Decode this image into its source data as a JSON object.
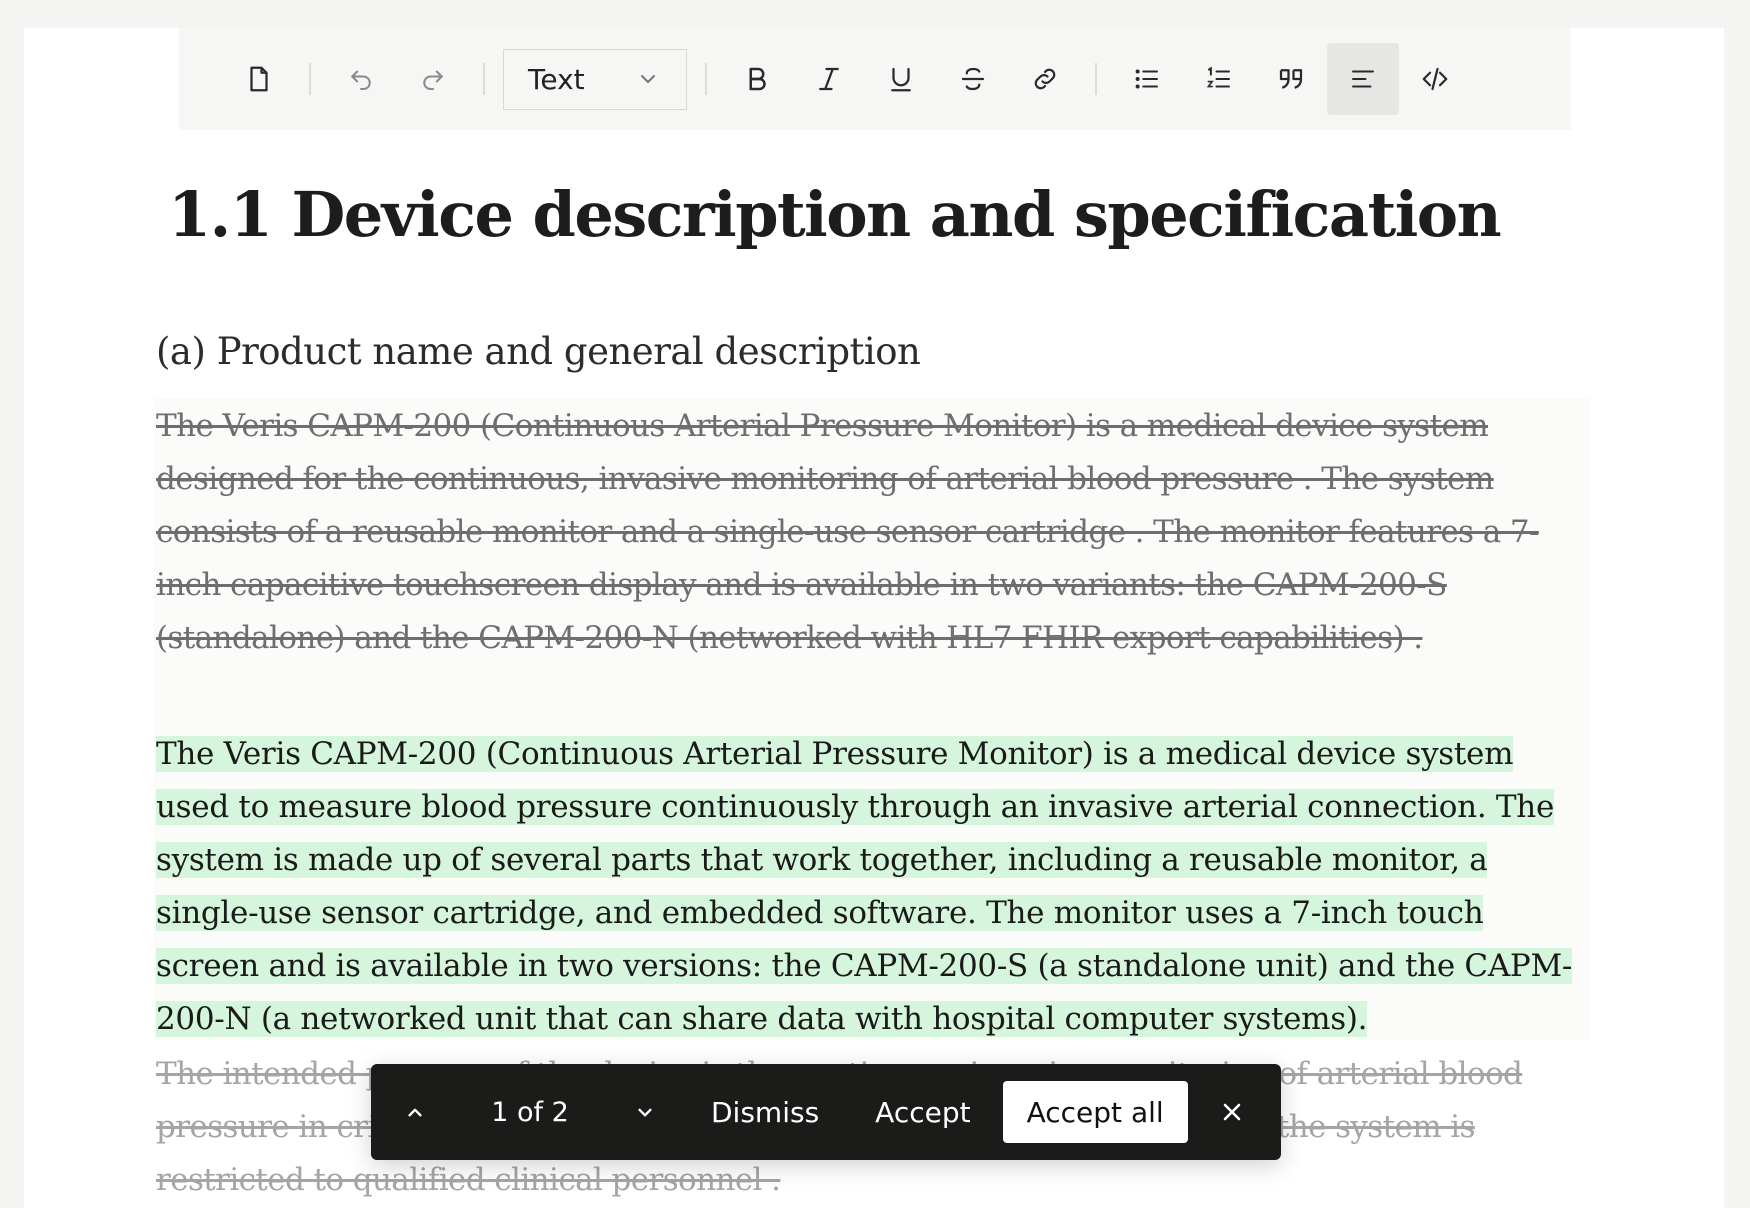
{
  "toolbar": {
    "block_type": "Text",
    "icons": [
      "file-icon",
      "undo-icon",
      "redo-icon",
      "bold-icon",
      "italic-icon",
      "underline-icon",
      "strikethrough-icon",
      "link-icon",
      "bullet-list-icon",
      "numbered-list-icon",
      "quote-icon",
      "align-left-icon",
      "code-icon"
    ]
  },
  "document": {
    "title": "1.1 Device description and specification",
    "section_heading": "(a) Product name and general description",
    "deleted_paragraph": "The Veris CAPM-200 (Continuous Arterial Pressure Monitor) is a medical device system designed for the continuous, invasive monitoring of arterial blood pressure . The system consists of a reusable monitor and a single-use sensor cartridge . The monitor features a 7-inch capacitive touchscreen display and is available in two variants: the CAPM-200-S (standalone) and the CAPM-200-N (networked with HL7 FHIR export capabilities) .",
    "inserted_paragraph": "The Veris CAPM-200 (Continuous Arterial Pressure Monitor) is a medical device system used to measure blood pressure continuously through an invasive arterial connection. The system is made up of several parts that work together, including a reusable monitor, a single-use sensor cartridge, and embedded software. The monitor uses a 7-inch touch screen and is available in two versions: the CAPM-200-S (a standalone unit) and the CAPM-200-N (a networked unit that can share data with hospital computer systems).",
    "next_deleted_paragraph": "The intended purpose of the device is the continuous invasive monitoring of arterial blood pressure in critical care and perioperative hospital environments . Use of the system is restricted to qualified clinical personnel ."
  },
  "review_bar": {
    "counter": "1 of 2",
    "dismiss_label": "Dismiss",
    "accept_label": "Accept",
    "accept_all_label": "Accept all"
  },
  "colors": {
    "insert_highlight": "#d6f5dd",
    "review_bar_bg": "#1b1b19",
    "active_tool_bg": "#e6e6e4"
  }
}
